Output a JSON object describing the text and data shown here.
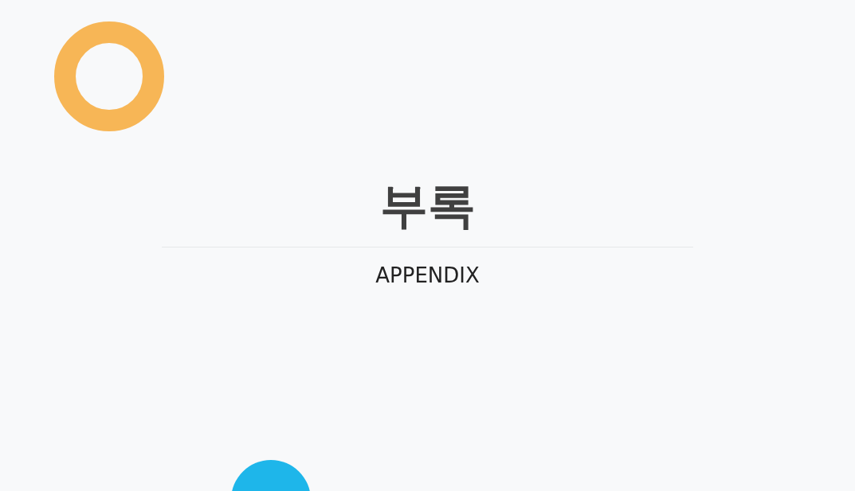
{
  "title": "부록",
  "subtitle": "APPENDIX"
}
